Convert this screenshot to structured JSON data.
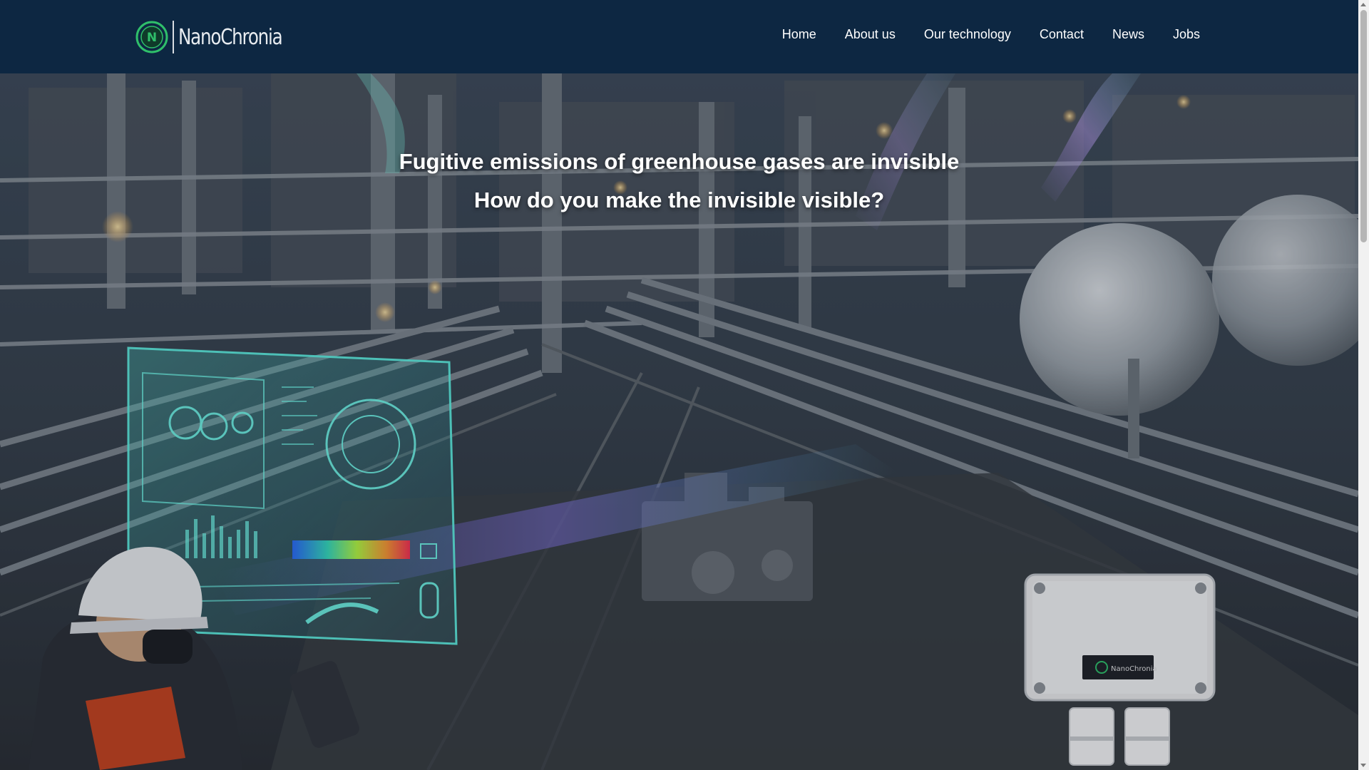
{
  "brand": {
    "name": "NanoChronia",
    "logo_letter": "N"
  },
  "nav": {
    "items": [
      "Home",
      "About us",
      "Our technology",
      "Contact",
      "News",
      "Jobs"
    ]
  },
  "hero": {
    "headline_1": "Fugitive emissions of greenhouse gases are invisible",
    "headline_2": "How do you make the invisible visible?",
    "device_label": "NanoChronia"
  },
  "colors": {
    "header_bg": "#0d2742",
    "accent_green": "#2fbf6a",
    "text": "#ffffff"
  },
  "icons": {
    "logo": "nanochronia-logo-icon"
  }
}
